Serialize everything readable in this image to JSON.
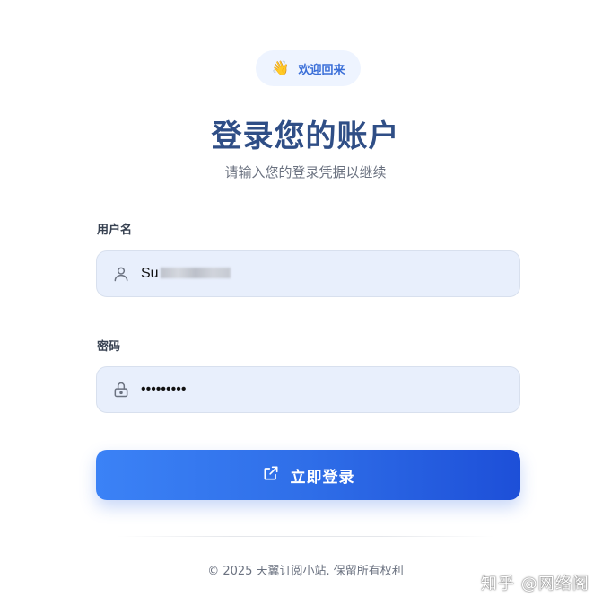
{
  "welcome": {
    "wave_icon": "waving-hand-icon",
    "wave_glyph": "👋",
    "text": "欢迎回来"
  },
  "title": "登录您的账户",
  "subtitle": "请输入您的登录凭据以继续",
  "username": {
    "label": "用户名",
    "icon": "user-icon",
    "value": "Su"
  },
  "password": {
    "label": "密码",
    "icon": "lock-icon",
    "value": "•••••••••"
  },
  "login_button": {
    "icon": "external-link-icon",
    "label": "立即登录"
  },
  "footer": "© 2025 天翼订阅小站. 保留所有权利",
  "watermark": "知乎 @网络阁",
  "colors": {
    "accent": "#3b82f6",
    "accent_dark": "#1d4fd8",
    "title": "#2f4e86",
    "input_bg": "#e8effc"
  }
}
